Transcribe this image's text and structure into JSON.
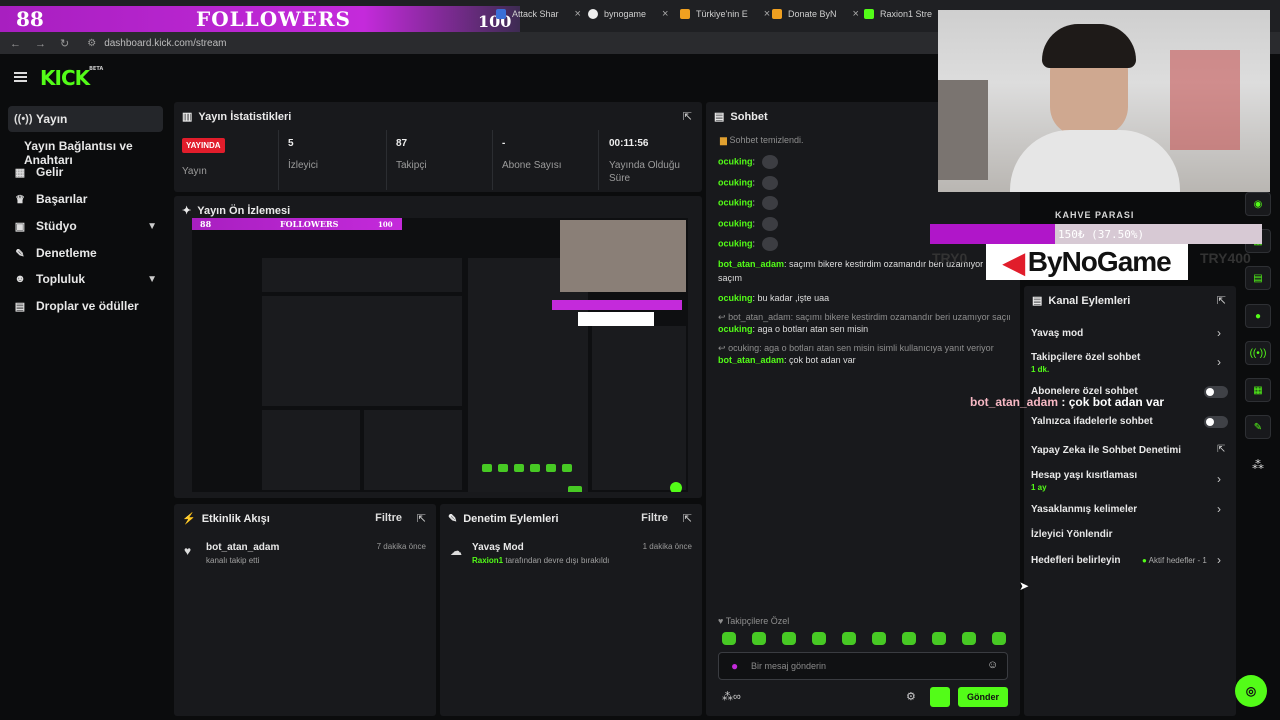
{
  "browser": {
    "tabs": [
      {
        "label": "Attack Shar",
        "color": "#3a6fd8"
      },
      {
        "label": "bynogame",
        "color": "#eeeeee"
      },
      {
        "label": "Türkiye'nin E",
        "color": "#f0a020"
      },
      {
        "label": "Donate ByN",
        "color": "#f0a020"
      },
      {
        "label": "Raxion1 Stre",
        "color": "#53fc18"
      }
    ],
    "url": "dashboard.kick.com/stream"
  },
  "overlay": {
    "followers_count": "88",
    "followers_label": "FOLLOWERS",
    "followers_goal": "100",
    "donate_title": "KAHVE PARASI",
    "donate_progress": "150₺ (37.50%)",
    "donate_fraction": 0.375,
    "sponsor": "ByNoGame",
    "try_left": "TRY0",
    "try_right": "TRY400",
    "alert_user": "bot_atan_adam",
    "alert_message": " : çok bot adan var"
  },
  "header": {
    "logo": "KICK",
    "logo_tag": "BETA"
  },
  "sidebar": {
    "items": [
      {
        "label": "Yayın",
        "icon": "broadcast-icon"
      },
      {
        "label": "Gelir",
        "icon": "revenue-icon"
      },
      {
        "label": "Başarılar",
        "icon": "trophy-icon"
      },
      {
        "label": "Stüdyo",
        "icon": "studio-icon"
      },
      {
        "label": "Denetleme",
        "icon": "wrench-icon"
      },
      {
        "label": "Topluluk",
        "icon": "community-icon"
      },
      {
        "label": "Droplar ve ödüller",
        "icon": "gift-icon"
      }
    ],
    "sub_item": "Yayın Bağlantısı ve Anahtarı"
  },
  "stats": {
    "title": "Yayın İstatistikleri",
    "live_badge": "YAYINDA",
    "stream_label": "Yayın",
    "viewers_value": "5",
    "viewers_label": "İzleyici",
    "followers_value": "87",
    "followers_label": "Takipçi",
    "subs_value": "-",
    "subs_label": "Abone Sayısı",
    "duration_value": "00:11:56",
    "duration_label": "Yayında Olduğu Süre"
  },
  "preview": {
    "title": "Yayın Ön İzlemesi",
    "banner_count": "88",
    "banner_label": "FOLLOWERS",
    "banner_goal": "100"
  },
  "activity": {
    "title": "Etkinlik Akışı",
    "filter": "Filtre",
    "item_user": "bot_atan_adam",
    "item_desc": "kanalı takip etti",
    "item_time": "7 dakika önce"
  },
  "moderation": {
    "title": "Denetim Eylemleri",
    "filter": "Filtre",
    "item_title": "Yavaş Mod",
    "item_user": "Raxion1",
    "item_desc": " tarafından devre dışı bırakıldı",
    "item_time": "1 dakika önce"
  },
  "chat": {
    "title": "Sohbet",
    "cleared": "Sohbet temizlendi.",
    "messages": [
      {
        "user": "ocuking",
        "text": ""
      },
      {
        "user": "ocuking",
        "text": ""
      },
      {
        "user": "ocuking",
        "text": ""
      },
      {
        "user": "ocuking",
        "text": ""
      },
      {
        "user": "ocuking",
        "text": ""
      },
      {
        "user": "bot_atan_adam",
        "text": "saçımı bikere kestirdim ozamandır beri uzamıyor"
      },
      {
        "user": "",
        "text": "saçım"
      },
      {
        "user": "ocuking",
        "text": "bu kadar ,işte uaa"
      },
      {
        "user": "",
        "text": "bot_atan_adam: saçımı bikere kestirdim ozamandır beri uzamıyor saçım..."
      },
      {
        "user": "ocuking",
        "text": "aga o botları atan sen misin"
      },
      {
        "user": "",
        "text": "ocuking: aga o botları atan sen misin isimli kullanıcıya yanıt veriyor"
      },
      {
        "user": "bot_atan_adam",
        "text": "çok bot adan var"
      }
    ],
    "followers_only": "Takipçilere Özel",
    "input_placeholder": "Bir mesaj gönderin",
    "send_label": "Gönder"
  },
  "channel_actions": {
    "title": "Kanal Eylemleri",
    "slow_mode": "Yavaş mod",
    "followers_chat": "Takipçilere özel sohbet",
    "followers_chat_sub": "1 dk.",
    "subs_chat": "Abonelere özel sohbet",
    "emotes_chat": "Yalnızca ifadelerle sohbet",
    "ai_moderation": "Yapay Zeka ile Sohbet Denetimi",
    "account_age": "Hesap yaşı kısıtlaması",
    "account_age_sub": "1 ay",
    "banned_words": "Yasaklanmış kelimeler",
    "redirect": "İzleyici Yönlendir",
    "goals": "Hedefleri belirleyin",
    "goals_active": "Aktif hedefler - 1"
  },
  "colors": {
    "accent": "#53fc18",
    "live": "#e11d2b",
    "panel": "#18191c",
    "overlay_purple": "#b016c9"
  }
}
